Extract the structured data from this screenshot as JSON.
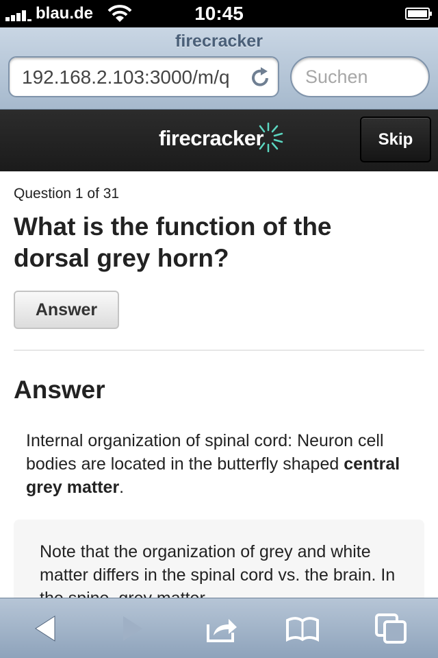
{
  "status_bar": {
    "carrier": "blau.de",
    "time": "10:45"
  },
  "browser": {
    "page_title": "firecracker",
    "url": "192.168.2.103:3000/m/q",
    "search_placeholder": "Suchen"
  },
  "app_header": {
    "logo_text": "firecracker",
    "skip_label": "Skip"
  },
  "question": {
    "counter": "Question 1 of 31",
    "text": "What is the function of the dorsal grey horn?",
    "answer_button_label": "Answer"
  },
  "answer": {
    "heading": "Answer",
    "para_prefix": "Internal organization of spinal cord: Neuron cell bodies are located in the butterfly shaped ",
    "para_bold": "central grey matter",
    "para_suffix": ".",
    "note_text": "Note that the organization of grey and white matter differs in the spinal cord vs. the brain. In the spine, grey matter"
  },
  "toolbar": {
    "icons": [
      "back-arrow-icon",
      "forward-arrow-icon",
      "share-icon",
      "bookmarks-icon",
      "tabs-icon"
    ]
  },
  "colors": {
    "header_bg": "#1b1b1b",
    "logo_accent": "#5bd6c0",
    "browser_chrome": "#a6b9cd"
  }
}
